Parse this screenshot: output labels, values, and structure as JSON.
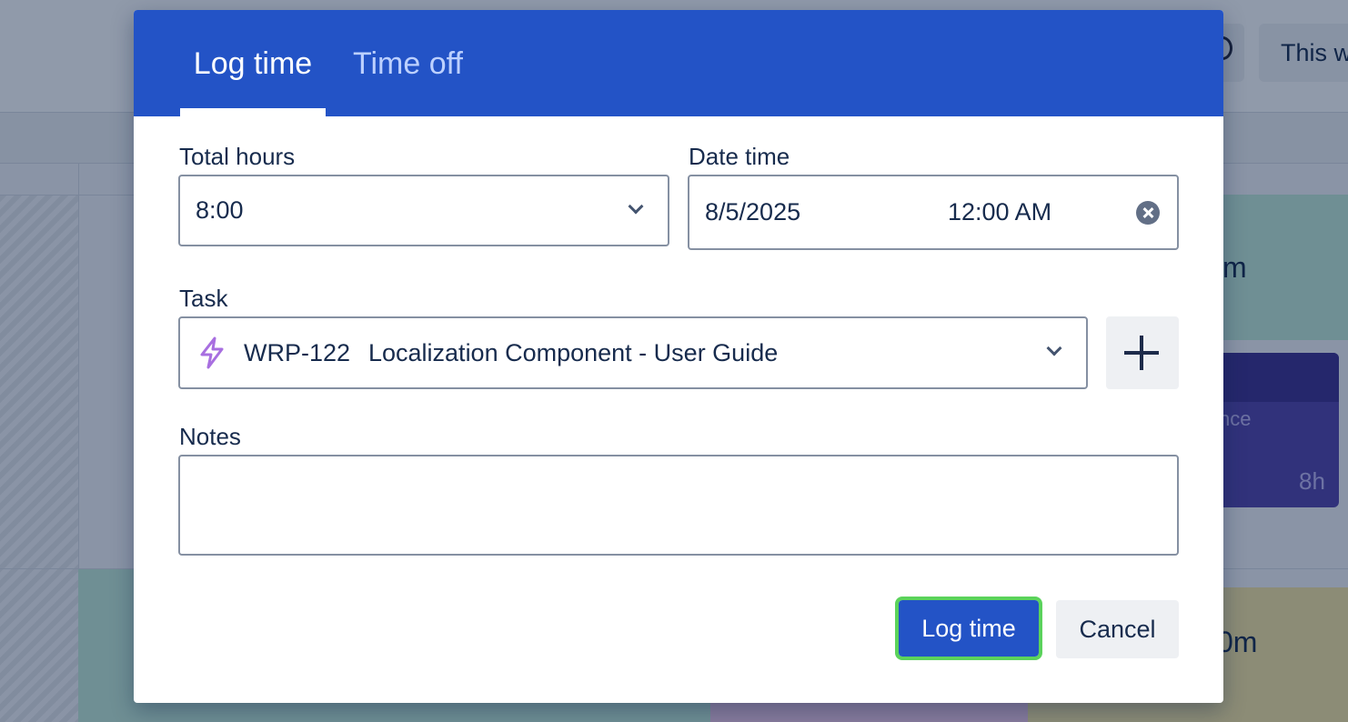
{
  "background": {
    "week_button_label": "This w",
    "card_green_text": "m",
    "card_purple_text": "nce",
    "card_purple_hours": "8h",
    "card_yellow_text": "0m"
  },
  "modal": {
    "tabs": [
      {
        "label": "Log time",
        "active": true
      },
      {
        "label": "Time off",
        "active": false
      }
    ],
    "total_hours": {
      "label": "Total hours",
      "value": "8:00"
    },
    "date_time": {
      "label": "Date time",
      "date": "8/5/2025",
      "time": "12:00 AM"
    },
    "task": {
      "label": "Task",
      "key": "WRP-122",
      "name": "Localization Component - User Guide",
      "icon": "lightning-bolt-icon"
    },
    "notes": {
      "label": "Notes",
      "value": ""
    },
    "actions": {
      "submit_label": "Log time",
      "cancel_label": "Cancel"
    },
    "colors": {
      "header": "#2353c6",
      "task_icon": "#a86fe0",
      "focus_ring": "#5bd35b"
    }
  }
}
